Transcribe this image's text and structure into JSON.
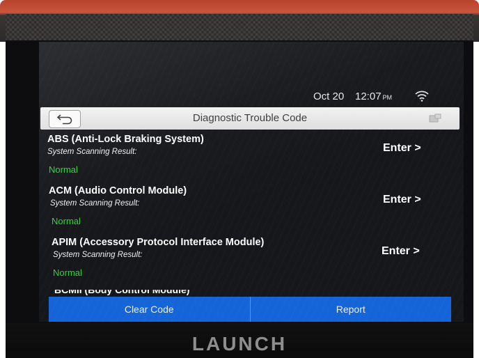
{
  "device": {
    "brand": "LAUNCH"
  },
  "status_bar": {
    "date": "Oct 20",
    "time": "12:07",
    "ampm": "PM",
    "wifi_icon": "wifi-icon"
  },
  "header": {
    "title": "Diagnostic Trouble Code",
    "back_icon": "back-arrow-icon",
    "menu_icon": "menu-icon"
  },
  "modules": [
    {
      "name": "ABS (Anti-Lock Braking System)",
      "scan_label": "System Scanning Result:",
      "result": "Normal",
      "enter_label": "Enter >"
    },
    {
      "name": "ACM (Audio Control Module)",
      "scan_label": "System Scanning Result:",
      "result": "Normal",
      "enter_label": "Enter >"
    },
    {
      "name": "APIM (Accessory Protocol Interface Module)",
      "scan_label": "System Scanning Result:",
      "result": "Normal",
      "enter_label": "Enter >"
    },
    {
      "name": "BCMII (Body Control Module)"
    }
  ],
  "actions": {
    "clear_code": "Clear Code",
    "report": "Report"
  },
  "colors": {
    "action_bar": "#1565d8",
    "result_ok": "#34d23a",
    "title_bar": "#e8e8e8"
  }
}
